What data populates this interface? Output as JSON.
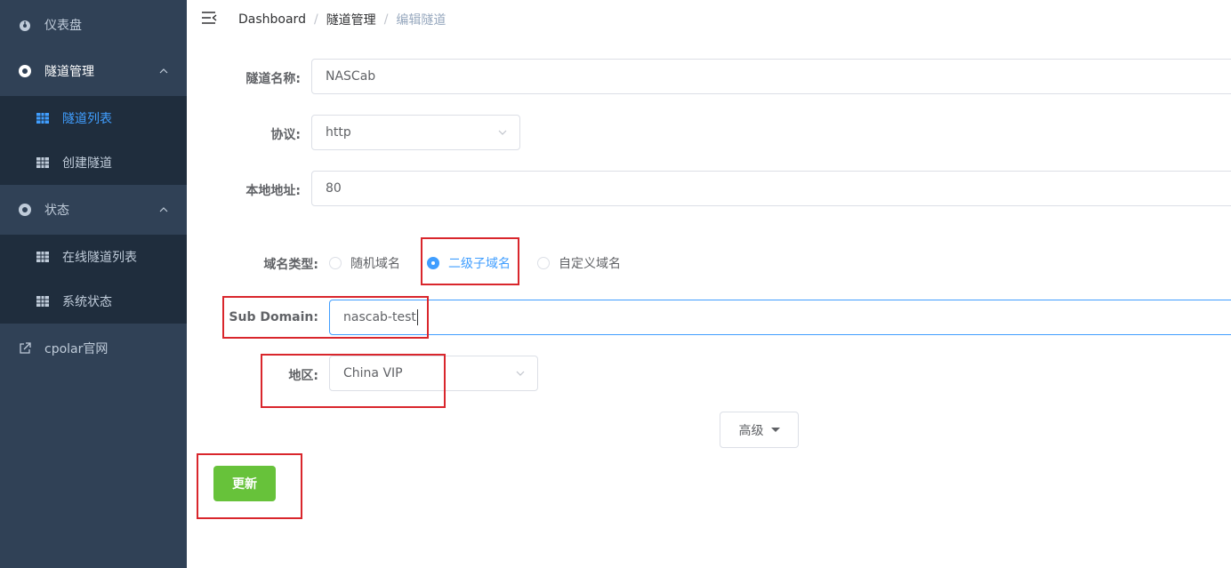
{
  "sidebar": {
    "items": [
      {
        "label": "仪表盘",
        "icon": "dashboard-icon"
      },
      {
        "label": "隧道管理",
        "icon": "tunnel-manage-icon"
      },
      {
        "label": "隧道列表",
        "icon": "grid-icon"
      },
      {
        "label": "创建隧道",
        "icon": "grid-icon"
      },
      {
        "label": "状态",
        "icon": "status-icon"
      },
      {
        "label": "在线隧道列表",
        "icon": "grid-icon"
      },
      {
        "label": "系统状态",
        "icon": "grid-icon"
      },
      {
        "label": "cpolar官网",
        "icon": "external-link-icon"
      }
    ]
  },
  "breadcrumb": [
    "Dashboard",
    "隧道管理",
    "编辑隧道"
  ],
  "form": {
    "tunnel_name_label": "隧道名称:",
    "tunnel_name_value": "NASCab",
    "protocol_label": "协议:",
    "protocol_value": "http",
    "local_addr_label": "本地地址:",
    "local_addr_value": "80",
    "domain_type_label": "域名类型:",
    "domain_types": [
      "随机域名",
      "二级子域名",
      "自定义域名"
    ],
    "domain_type_selected": "二级子域名",
    "subdomain_label": "Sub Domain:",
    "subdomain_value": "nascab-test",
    "region_label": "地区:",
    "region_value": "China VIP",
    "advanced_label": "高级",
    "update_label": "更新"
  },
  "colors": {
    "sidebar_bg": "#304156",
    "submenu_bg": "#1f2d3d",
    "accent": "#409eff",
    "update_button": "#67c23a",
    "highlight_box": "#d9262c"
  }
}
